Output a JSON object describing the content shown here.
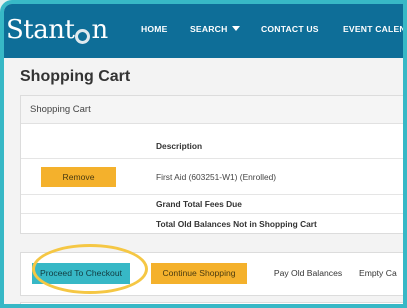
{
  "nav": {
    "logo_pre": "Stant",
    "logo_post": "n",
    "items": [
      "HOME",
      "SEARCH",
      "CONTACT US",
      "EVENT CALENDA"
    ]
  },
  "page": {
    "title": "Shopping Cart"
  },
  "cart": {
    "panel_title": "Shopping Cart",
    "header": {
      "description": "Description"
    },
    "item": {
      "remove_label": "Remove",
      "description": "First Aid (603251-W1) (Enrolled)"
    },
    "grand_total_label": "Grand Total Fees Due",
    "old_balances_label": "Total Old Balances Not in Shopping Cart"
  },
  "actions": {
    "checkout": "Proceed To Checkout",
    "continue": "Continue Shopping",
    "pay_old": "Pay Old Balances",
    "empty": "Empty Ca"
  },
  "colors": {
    "nav": "#0e6e98",
    "accent_teal": "#37b8c6",
    "accent_orange": "#f4b12c",
    "highlight": "#f5c744"
  }
}
